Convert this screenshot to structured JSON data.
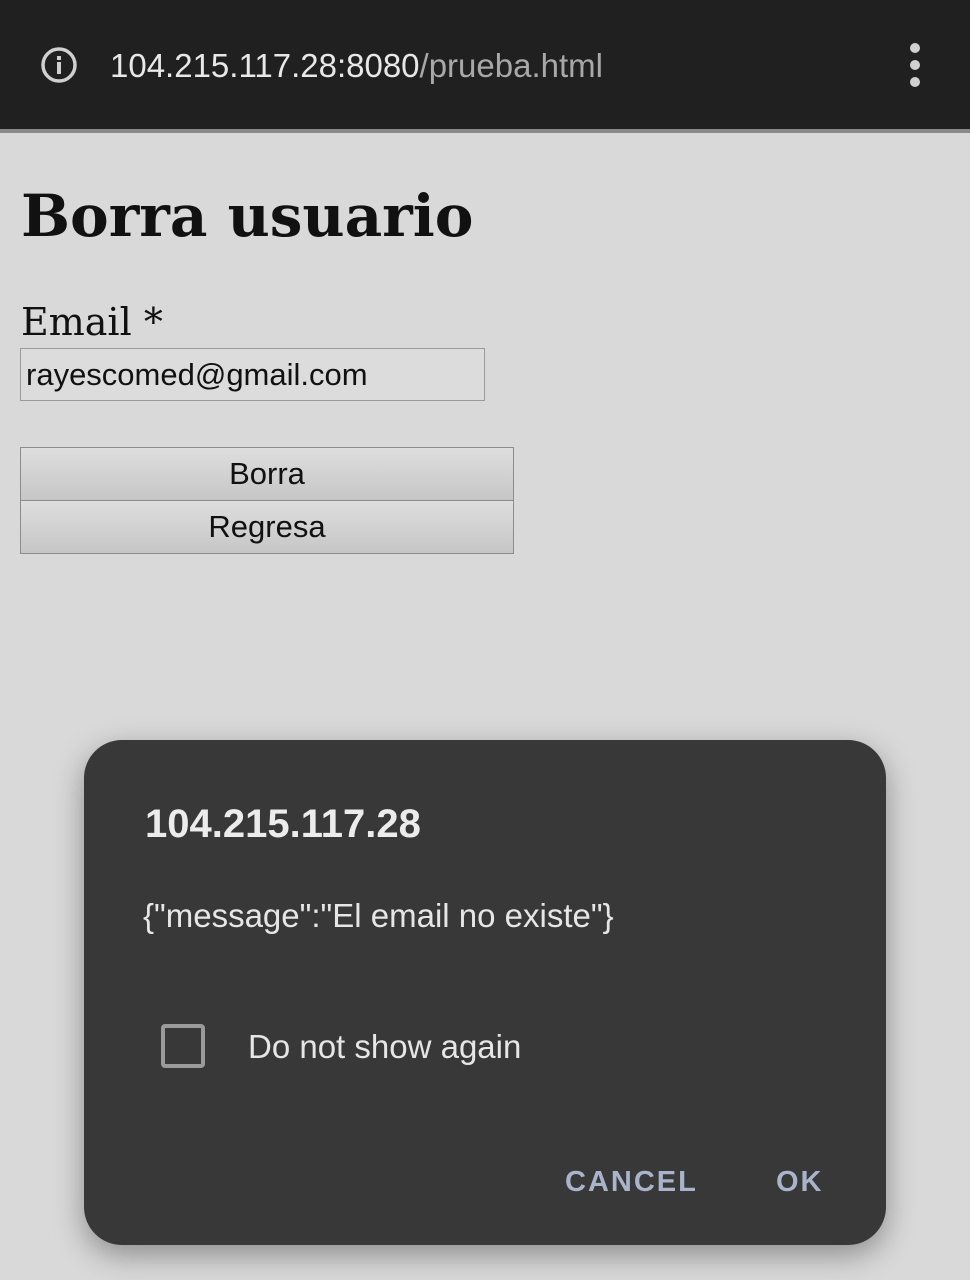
{
  "browser": {
    "url_host": "104.215.117.28:8080",
    "url_path": "/prueba.html",
    "info_icon": "info-icon",
    "menu_icon": "more-vert-icon"
  },
  "page": {
    "title": "Borra usuario",
    "email_label": "Email *",
    "email_value": "rayescomed@gmail.com",
    "borra_button": "Borra",
    "regresa_button": "Regresa"
  },
  "dialog": {
    "title": "104.215.117.28",
    "message": "{\"message\":\"El email no existe\"}",
    "checkbox_label": "Do not show again",
    "checkbox_checked": false,
    "cancel_label": "CANCEL",
    "ok_label": "OK"
  },
  "colors": {
    "toolbar_bg": "#202020",
    "page_bg": "#d9d9d9",
    "dialog_bg": "#383838",
    "dialog_button": "#a9b3c9"
  }
}
